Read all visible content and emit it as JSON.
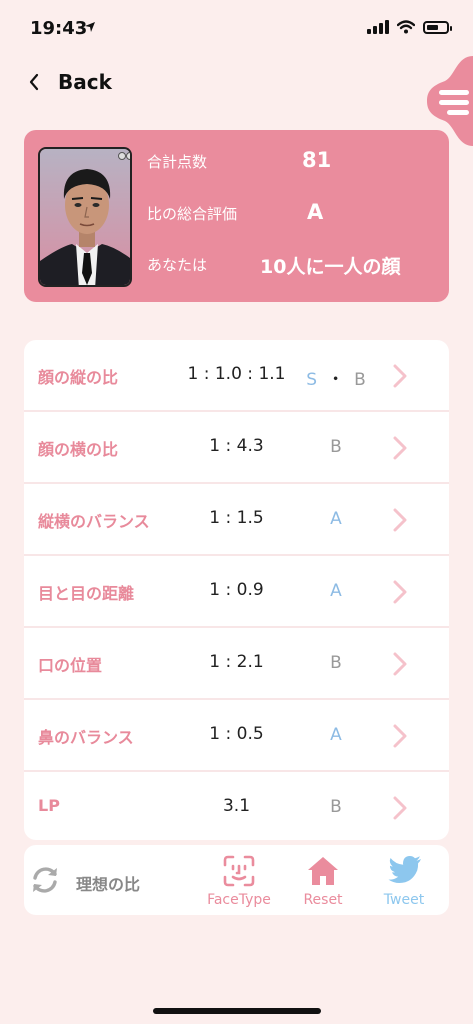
{
  "status_bar": {
    "time": "19:43"
  },
  "nav": {
    "back_label": "Back"
  },
  "summary": {
    "rows": [
      {
        "label": "合計点数",
        "value": "81"
      },
      {
        "label": "比の総合評価",
        "value": "A"
      },
      {
        "label": "あなたは",
        "value": "10人に一人の顔"
      }
    ]
  },
  "ratios": [
    {
      "label": "顔の縦の比",
      "value": "1 : 1.0 : 1.1",
      "grades": [
        "S",
        "B"
      ]
    },
    {
      "label": "顔の横の比",
      "value": "1 : 4.3",
      "grades": [
        "B"
      ]
    },
    {
      "label": "縦横のバランス",
      "value": "1 : 1.5",
      "grades": [
        "A"
      ]
    },
    {
      "label": "目と目の距離",
      "value": "1 : 0.9",
      "grades": [
        "A"
      ]
    },
    {
      "label": "口の位置",
      "value": "1 : 2.1",
      "grades": [
        "B"
      ]
    },
    {
      "label": "鼻のバランス",
      "value": "1 : 0.5",
      "grades": [
        "A"
      ]
    },
    {
      "label": "LP",
      "value": "3.1",
      "grades": [
        "B"
      ]
    }
  ],
  "toolbar": {
    "ideal_label": "理想の比",
    "facetype_label": "FaceType",
    "reset_label": "Reset",
    "tweet_label": "Tweet"
  },
  "colors": {
    "accent_pink": "#ea8c9d",
    "background": "#fceeed",
    "grade_good": "#8dbbe4",
    "grade_neutral": "#999999",
    "twitter_blue": "#8dc7ee"
  }
}
